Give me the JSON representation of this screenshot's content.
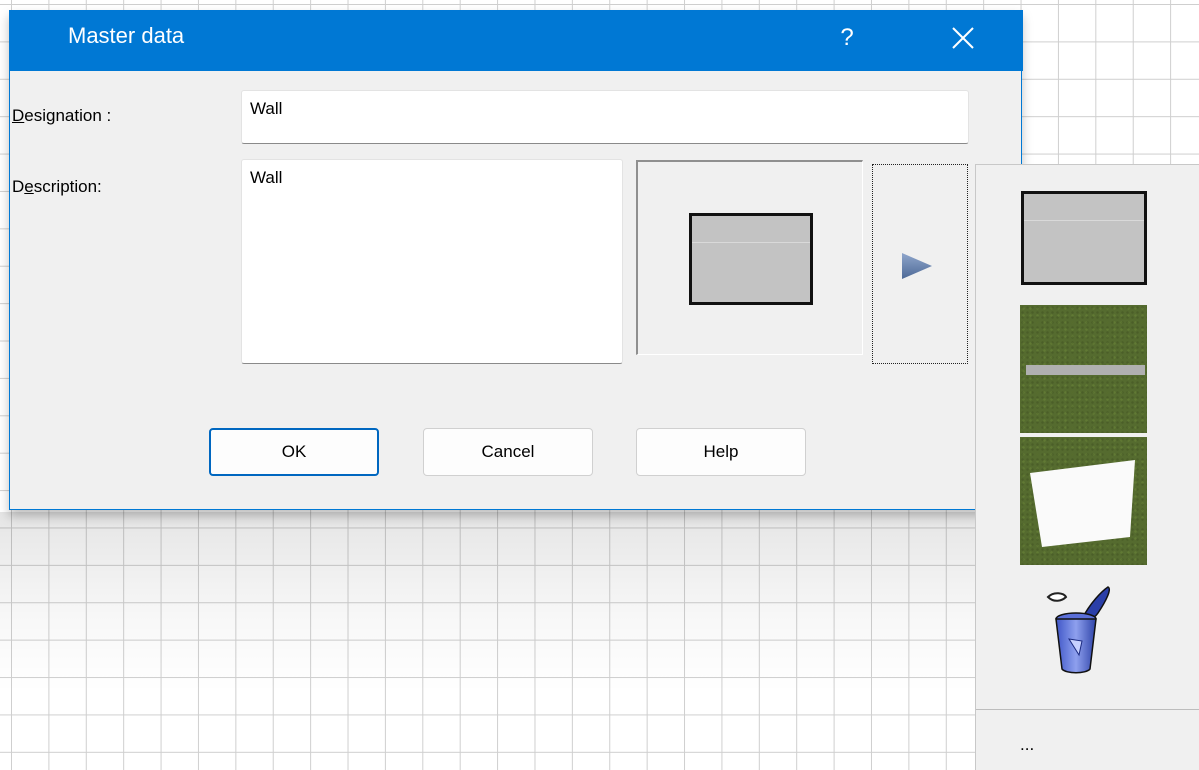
{
  "dialog": {
    "title": "Master data",
    "help_glyph": "?",
    "designation_label_accel": "D",
    "designation_label_rest": "esignation :",
    "designation_value": "Wall",
    "description_label_pre": "D",
    "description_label_accel": "e",
    "description_label_rest": "scription:",
    "description_value": "Wall",
    "buttons": {
      "ok": "OK",
      "cancel": "Cancel",
      "help": "Help"
    }
  },
  "material_panel": {
    "items": [
      "wall-swatch",
      "grass-with-line",
      "grass-with-white-plane",
      "recycle-bin-icon"
    ],
    "more_label": "..."
  },
  "colors": {
    "titlebar": "#0078d4",
    "dialog_bg": "#f0f0f0",
    "grass": "#556b2f",
    "wall_fill": "#c3c3c3"
  }
}
